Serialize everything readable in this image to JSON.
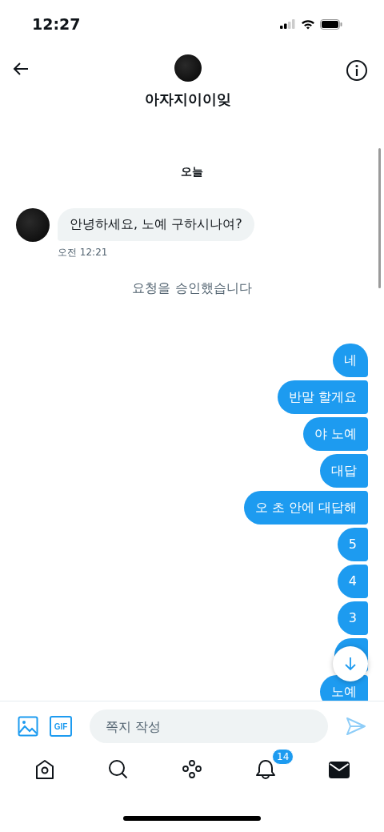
{
  "status_bar": {
    "time": "12:27"
  },
  "header": {
    "name": "아자지이이잊"
  },
  "day_label": "오늘",
  "incoming": {
    "text": "안녕하세요, 노예 구하시나여?",
    "time": "오전 12:21"
  },
  "system_note": "요청을 승인했습니다",
  "messages": [
    {
      "text": "네"
    },
    {
      "text": "반말 할게요"
    },
    {
      "text": "야 노예"
    },
    {
      "text": "대답"
    },
    {
      "text": "오 초 안에 대답해"
    },
    {
      "text": "5"
    },
    {
      "text": "4"
    },
    {
      "text": "3"
    },
    {
      "kind": "covered"
    },
    {
      "text": "노예"
    }
  ],
  "composer": {
    "gif_label": "GIF",
    "placeholder": "쪽지 작성"
  },
  "tab_bar": {
    "items": [
      {
        "kind": "home",
        "selected": false
      },
      {
        "kind": "search",
        "selected": false
      },
      {
        "kind": "spaces",
        "selected": false
      },
      {
        "kind": "notifications",
        "selected": false,
        "badge": "14"
      },
      {
        "kind": "messages",
        "selected": true
      }
    ]
  }
}
